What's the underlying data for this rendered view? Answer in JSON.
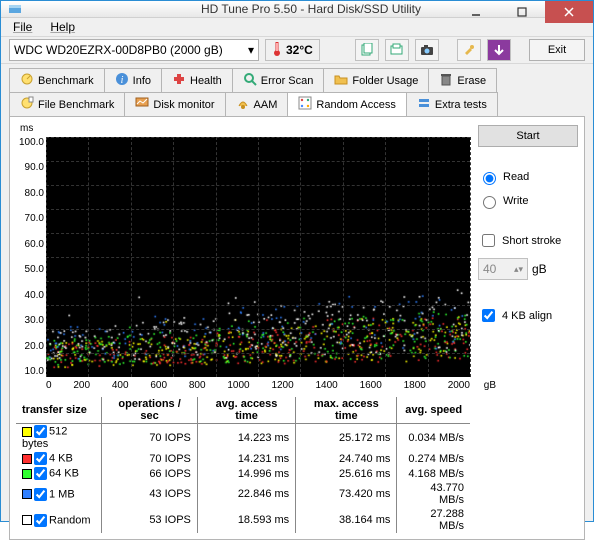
{
  "window": {
    "title": "HD Tune Pro 5.50 - Hard Disk/SSD Utility"
  },
  "menu": {
    "file": "File",
    "help": "Help"
  },
  "toolbar": {
    "drive": "WDC WD20EZRX-00D8PB0 (2000 gB)",
    "temp": "32°C",
    "exit": "Exit"
  },
  "tabs_row1": [
    {
      "label": "Benchmark",
      "icon": "benchmark-icon"
    },
    {
      "label": "Info",
      "icon": "info-icon"
    },
    {
      "label": "Health",
      "icon": "health-icon"
    },
    {
      "label": "Error Scan",
      "icon": "scan-icon"
    },
    {
      "label": "Folder Usage",
      "icon": "folder-icon"
    },
    {
      "label": "Erase",
      "icon": "erase-icon"
    }
  ],
  "tabs_row2": [
    {
      "label": "File Benchmark",
      "icon": "filebench-icon"
    },
    {
      "label": "Disk monitor",
      "icon": "monitor-icon"
    },
    {
      "label": "AAM",
      "icon": "aam-icon"
    },
    {
      "label": "Random Access",
      "icon": "random-icon",
      "active": true
    },
    {
      "label": "Extra tests",
      "icon": "extra-icon"
    }
  ],
  "side": {
    "start": "Start",
    "read": "Read",
    "write": "Write",
    "short_stroke": "Short stroke",
    "stroke_val": "40",
    "stroke_unit": "gB",
    "align": "4 KB align",
    "read_selected": true,
    "short_stroke_checked": false,
    "align_checked": true
  },
  "chart_data": {
    "type": "scatter",
    "title": "",
    "xlabel": "gB",
    "ylabel": "ms",
    "xlim": [
      0,
      2000
    ],
    "ylim": [
      0,
      100
    ],
    "xticks": [
      0,
      200,
      400,
      600,
      800,
      1000,
      1200,
      1400,
      1600,
      1800,
      2000
    ],
    "yticks": [
      10,
      20,
      30,
      40,
      50,
      60,
      70,
      80,
      90,
      100
    ],
    "y_unit_label": "ms",
    "x_unit_label": "gB",
    "series": [
      {
        "name": "512 bytes",
        "color": "#ffff00",
        "band_ms": [
          6,
          20
        ],
        "max_ms": 25.172
      },
      {
        "name": "4 KB",
        "color": "#ff3030",
        "band_ms": [
          6,
          20
        ],
        "max_ms": 24.74
      },
      {
        "name": "64 KB",
        "color": "#30ff30",
        "band_ms": [
          7,
          22
        ],
        "max_ms": 25.616
      },
      {
        "name": "1 MB",
        "color": "#3080ff",
        "band_ms": [
          10,
          30
        ],
        "max_ms": 73.42
      },
      {
        "name": "Random",
        "color": "#ffffff",
        "band_ms": [
          9,
          28
        ],
        "max_ms": 38.164
      }
    ]
  },
  "table": {
    "headers": [
      "transfer size",
      "operations / sec",
      "avg. access time",
      "max. access time",
      "avg. speed"
    ],
    "rows": [
      {
        "color": "#ffff00",
        "checked": true,
        "size": "512 bytes",
        "ops": "70 IOPS",
        "avg": "14.223 ms",
        "max": "25.172 ms",
        "speed": "0.034 MB/s"
      },
      {
        "color": "#ff3030",
        "checked": true,
        "size": "4 KB",
        "ops": "70 IOPS",
        "avg": "14.231 ms",
        "max": "24.740 ms",
        "speed": "0.274 MB/s"
      },
      {
        "color": "#30ff30",
        "checked": true,
        "size": "64 KB",
        "ops": "66 IOPS",
        "avg": "14.996 ms",
        "max": "25.616 ms",
        "speed": "4.168 MB/s"
      },
      {
        "color": "#3080ff",
        "checked": true,
        "size": "1 MB",
        "ops": "43 IOPS",
        "avg": "22.846 ms",
        "max": "73.420 ms",
        "speed": "43.770 MB/s"
      },
      {
        "color": "#ffffff",
        "checked": true,
        "size": "Random",
        "ops": "53 IOPS",
        "avg": "18.593 ms",
        "max": "38.164 ms",
        "speed": "27.288 MB/s"
      }
    ]
  }
}
